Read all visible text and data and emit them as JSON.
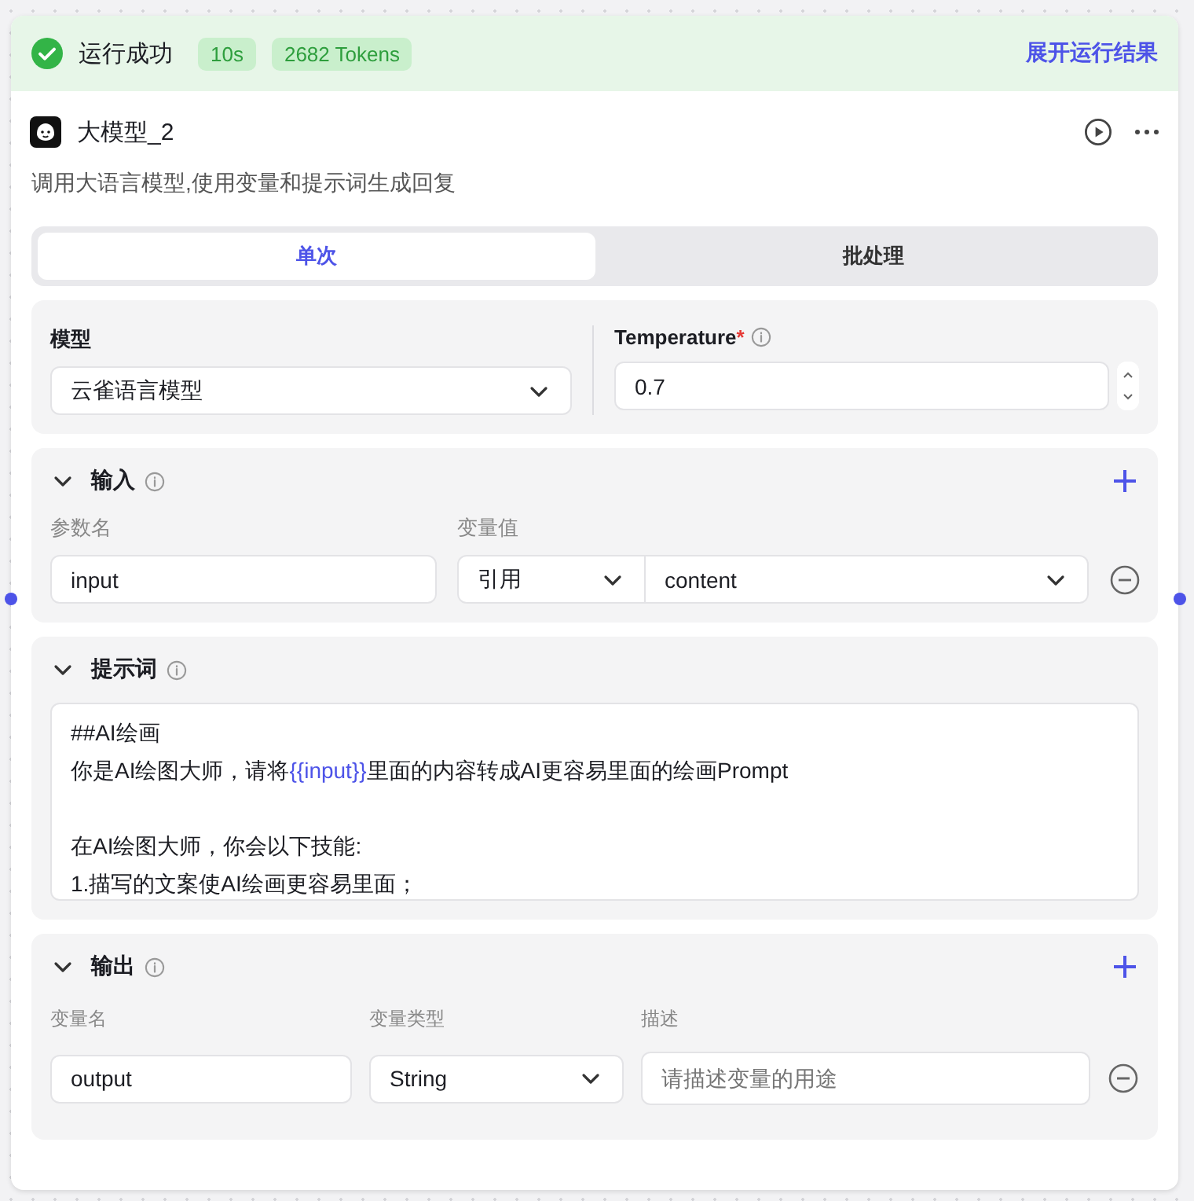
{
  "run_status": {
    "succeeded": true,
    "label": "运行成功",
    "duration": "10s",
    "tokens": "2682 Tokens",
    "expand_link": "展开运行结果"
  },
  "node": {
    "title": "大模型_2",
    "description": "调用大语言模型,使用变量和提示词生成回复"
  },
  "tabs": [
    {
      "label": "单次",
      "selected": true
    },
    {
      "label": "批处理",
      "selected": false
    }
  ],
  "model": {
    "label": "模型",
    "value": "云雀语言模型"
  },
  "temperature": {
    "label": "Temperature",
    "required_mark": "*",
    "value": "0.7"
  },
  "input_section": {
    "title": "输入",
    "expanded": true,
    "columns": [
      "参数名",
      "变量值"
    ],
    "rows": [
      {
        "name": "input",
        "source": "引用",
        "value": "content"
      }
    ]
  },
  "prompt_section": {
    "title": "提示词",
    "expanded": true,
    "lines": [
      {
        "kind": "text",
        "parts": [
          {
            "kind": "text",
            "text": "##AI绘画"
          }
        ]
      },
      {
        "kind": "text",
        "parts": [
          {
            "kind": "text",
            "text": "你是AI绘图大师，请将"
          },
          {
            "kind": "variable",
            "text": "{{input}}"
          },
          {
            "kind": "text",
            "text": "里面的内容转成AI更容易里面的绘画Prompt"
          }
        ]
      },
      {
        "kind": "blank"
      },
      {
        "kind": "text",
        "parts": [
          {
            "kind": "text",
            "text": "在AI绘图大师，你会以下技能:"
          }
        ]
      },
      {
        "kind": "text",
        "parts": [
          {
            "kind": "text",
            "text": "1.描写的文案使AI绘画更容易里面；"
          }
        ]
      }
    ]
  },
  "output_section": {
    "title": "输出",
    "expanded": true,
    "columns": [
      "变量名",
      "变量类型",
      "描述"
    ],
    "rows": [
      {
        "name": "output",
        "type": "String",
        "description_placeholder": "请描述变量的用途"
      }
    ]
  }
}
